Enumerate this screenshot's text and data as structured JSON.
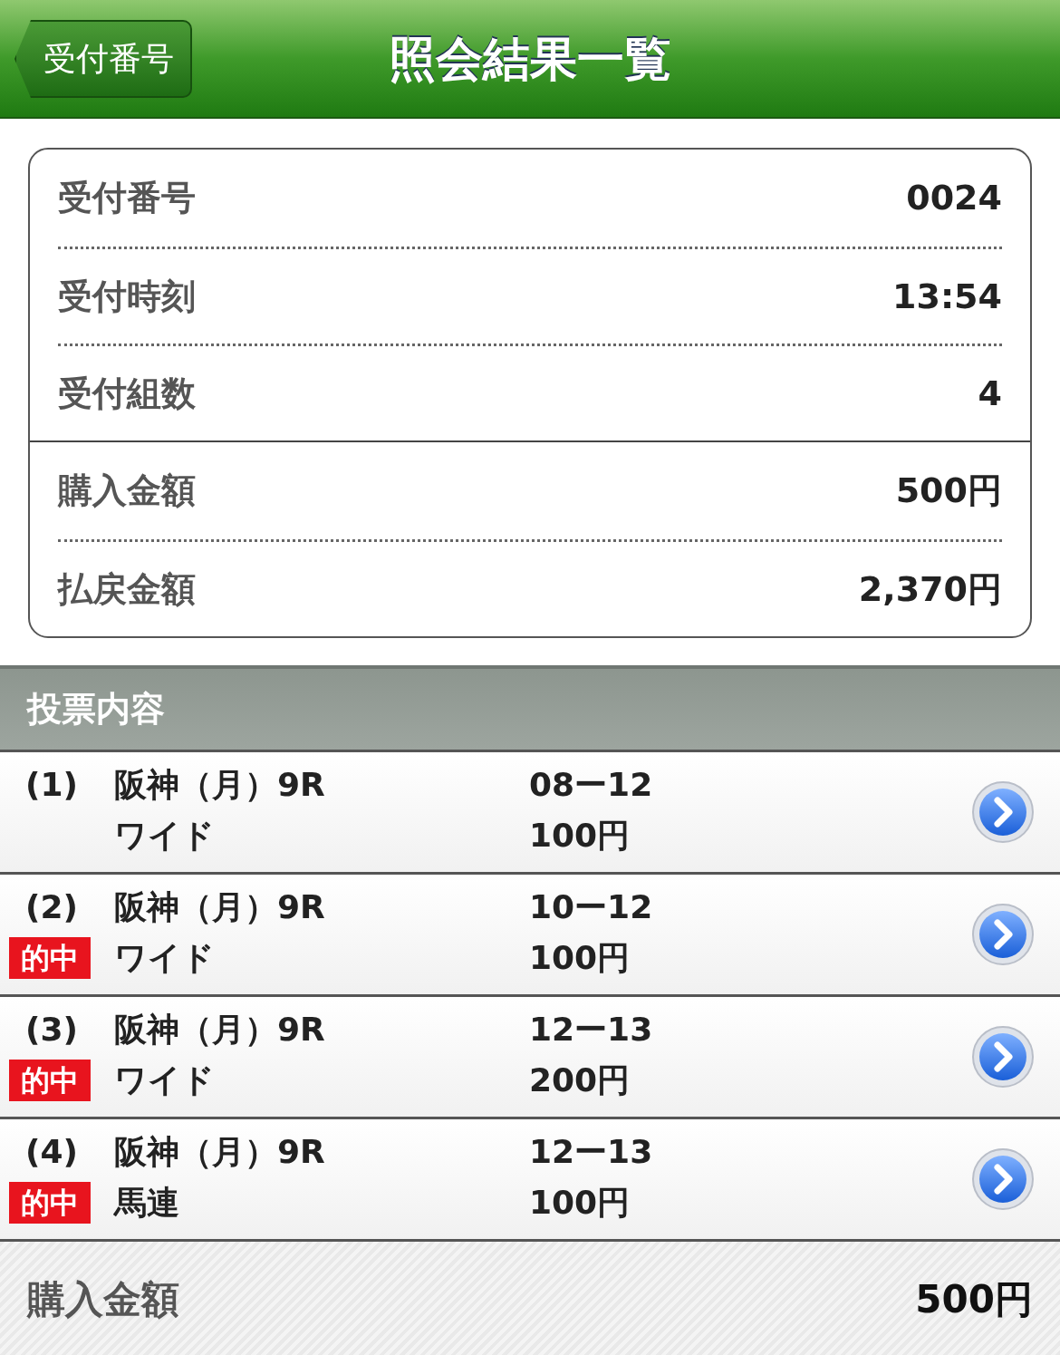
{
  "header": {
    "back_button": "受付番号",
    "title": "照会結果一覧"
  },
  "summary_groups": [
    {
      "rows": [
        {
          "label": "受付番号",
          "value": "0024"
        },
        {
          "label": "受付時刻",
          "value": "13:54"
        },
        {
          "label": "受付組数",
          "value": "4"
        }
      ]
    },
    {
      "rows": [
        {
          "label": "購入金額",
          "value": "500円"
        },
        {
          "label": "払戻金額",
          "value": "2,370円"
        }
      ]
    }
  ],
  "section_title": "投票内容",
  "bets": [
    {
      "number": "(1)",
      "venue": "阪神（月）9R",
      "bet_type": "ワイド",
      "combination": "08ー12",
      "amount": "100円"
    },
    {
      "number": "(2)",
      "hit_label": "的中",
      "venue": "阪神（月）9R",
      "bet_type": "ワイド",
      "combination": "10ー12",
      "amount": "100円"
    },
    {
      "number": "(3)",
      "hit_label": "的中",
      "venue": "阪神（月）9R",
      "bet_type": "ワイド",
      "combination": "12ー13",
      "amount": "200円"
    },
    {
      "number": "(4)",
      "hit_label": "的中",
      "venue": "阪神（月）9R",
      "bet_type": "馬連",
      "combination": "12ー13",
      "amount": "100円"
    }
  ],
  "footer": {
    "label": "購入金額",
    "value": "500円"
  }
}
